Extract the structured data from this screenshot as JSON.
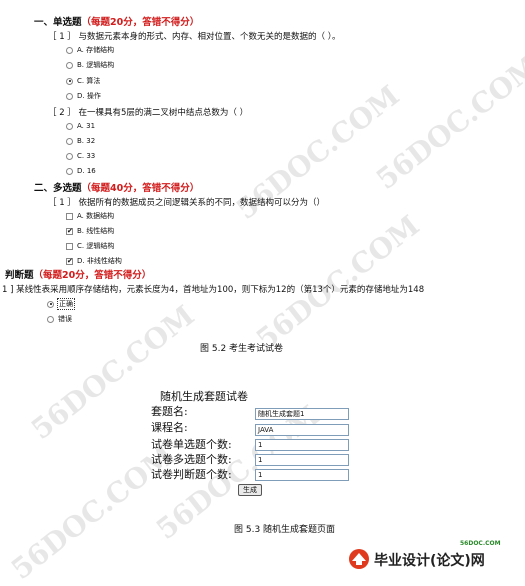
{
  "section1": {
    "title": "一、单选题",
    "note": "（每题20分，答错不得分）",
    "questions": [
      {
        "num": "［ 1 ］",
        "text": "与数据元素本身的形式、内存、相对位置、个数无关的是数据的（ ）。",
        "options": [
          "A. 存储结构",
          "B. 逻辑结构",
          "C. 算法",
          "D. 操作"
        ],
        "selected": 2
      },
      {
        "num": "［ 2 ］",
        "text": "在一棵具有5层的满二叉树中结点总数为（ ）",
        "options": [
          "A. 31",
          "B. 32",
          "C. 33",
          "D. 16"
        ],
        "selected": -1
      }
    ]
  },
  "section2": {
    "title": "二、多选题",
    "note": "（每题40分，答错不得分）",
    "question": {
      "num": "［ 1 ］",
      "text": "依据所有的数据成员之间逻辑关系的不同，数据结构可以分为（）",
      "options": [
        {
          "label": "A. 数据结构",
          "checked": false
        },
        {
          "label": "B. 线性结构",
          "checked": true
        },
        {
          "label": "C. 逻辑结构",
          "checked": false
        },
        {
          "label": "D. 非线性结构",
          "checked": true
        }
      ]
    }
  },
  "section3": {
    "title": "三、判断题",
    "note": "（每题20分，答错不得分）",
    "question": {
      "text": "1 ] 某线性表采用顺序存储结构，元素长度为4，首地址为100，则下标为12的（第13个）元素的存储地址为148",
      "options": [
        "正确",
        "错误"
      ],
      "selected": 0
    }
  },
  "caption1": "图 5.2   考生考试试卷",
  "form": {
    "title": "随机生成套题试卷",
    "fields": [
      {
        "label": "套题名:",
        "value": "随机生成套题1"
      },
      {
        "label": "课程名:",
        "value": "JAVA"
      },
      {
        "label": "试卷单选题个数:",
        "value": "1"
      },
      {
        "label": "试卷多选题个数:",
        "value": "1"
      },
      {
        "label": "试卷判断题个数:",
        "value": "1"
      }
    ],
    "submit": "生成"
  },
  "caption2": "图  5.3   随机生成套题页面",
  "watermark": "56DOC.COM",
  "logo": {
    "site": "56DOC.COM",
    "text": "毕业设计(论文)网"
  }
}
